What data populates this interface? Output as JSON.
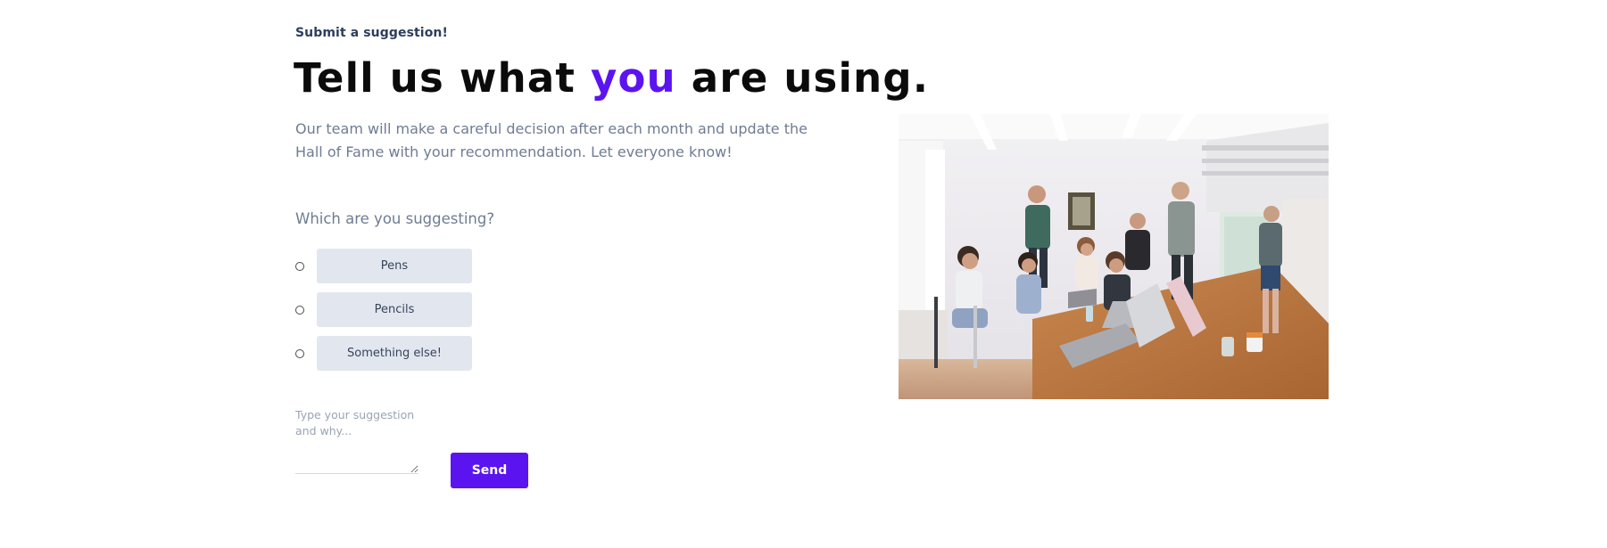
{
  "section": {
    "eyebrow": "Submit a suggestion!",
    "headline": {
      "before": "Tell us what",
      "highlight": "you",
      "after": "are using."
    },
    "description": "Our team will make a careful decision after each month and update the Hall of Fame with your recommendation. Let everyone know!"
  },
  "form": {
    "question": "Which are you suggesting?",
    "options": [
      {
        "label": "Pens",
        "selected": false
      },
      {
        "label": "Pencils",
        "selected": false
      },
      {
        "label": "Something else!",
        "selected": false
      }
    ],
    "suggestion_placeholder": "Type your suggestion and why...",
    "suggestion_value": "",
    "send_label": "Send"
  },
  "photo": {
    "subject": "team-meeting-photo"
  },
  "colors": {
    "accent": "#5b14f0",
    "heading": "#0b0b0b",
    "muted_text": "#6f7c93",
    "option_bg": "#e2e7ef"
  }
}
